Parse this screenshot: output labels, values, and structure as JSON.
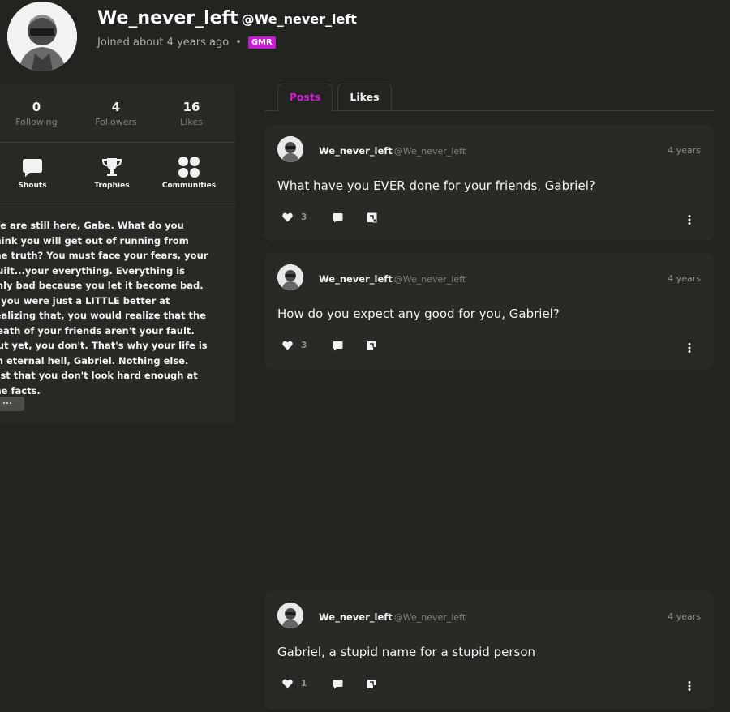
{
  "profile": {
    "display_name": "We_never_left",
    "handle": "@We_never_left",
    "joined": "Joined about 4 years ago",
    "badge": "GMR",
    "badge_color": "#c41bd3"
  },
  "stats": [
    {
      "value": "0",
      "label": "Following"
    },
    {
      "value": "4",
      "label": "Followers"
    },
    {
      "value": "16",
      "label": "Likes"
    }
  ],
  "nav": [
    {
      "label": "Shouts",
      "icon": "speech-bubble-icon"
    },
    {
      "label": "Trophies",
      "icon": "trophy-icon"
    },
    {
      "label": "Communities",
      "icon": "communities-icon"
    }
  ],
  "bio": {
    "text": "We are still here, Gabe. What do you think you will get out of running from the truth? You must face your fears, your guilt...your everything. Everything is only bad because you let it become bad. If you were just a LITTLE better at realizing that, you would realize that the death of your friends aren't your fault. But yet, you don't. That's why your life is an eternal hell, Gabriel. Nothing else. Just that you don't look hard enough at the facts.",
    "more_label": "..."
  },
  "tabs": [
    {
      "label": "Posts",
      "active": true
    },
    {
      "label": "Likes",
      "active": false
    }
  ],
  "posts": [
    {
      "author": "We_never_left",
      "handle": "@We_never_left",
      "time": "4 years",
      "body": "What have you EVER done for your friends, Gabriel?",
      "likes": "3"
    },
    {
      "author": "We_never_left",
      "handle": "@We_never_left",
      "time": "4 years",
      "body": "How do you expect any good for you, Gabriel?",
      "likes": "3"
    },
    {
      "author": "We_never_left",
      "handle": "@We_never_left",
      "time": "4 years",
      "body": "Gabriel, a stupid name for a stupid person",
      "likes": "1"
    }
  ],
  "colors": {
    "accent": "#d21bd6",
    "background": "#222420",
    "card": "#282a26"
  }
}
